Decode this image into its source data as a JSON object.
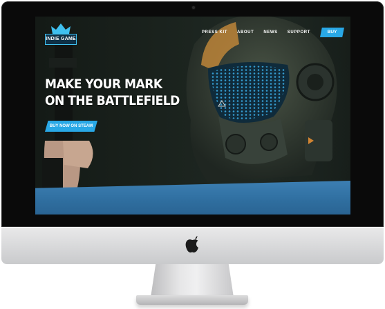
{
  "site": {
    "logo_text": "INDIE GAME",
    "nav": {
      "items": [
        {
          "label": "PRESS KIT"
        },
        {
          "label": "ABOUT"
        },
        {
          "label": "NEWS"
        },
        {
          "label": "SUPPORT"
        }
      ],
      "buy_label": "BUY"
    },
    "hero": {
      "headline_line1": "MAKE YOUR MARK",
      "headline_line2": "ON THE BATTLEFIELD",
      "cta_label": "BUY NOW ON STEAM"
    }
  },
  "colors": {
    "accent": "#29a8e6",
    "band": "#2f6e9f",
    "bezel": "#0a0a0a",
    "chin": "#d9dadb"
  },
  "icons": {
    "logo_crown": "crown-icon",
    "brand": "apple-logo-icon"
  }
}
